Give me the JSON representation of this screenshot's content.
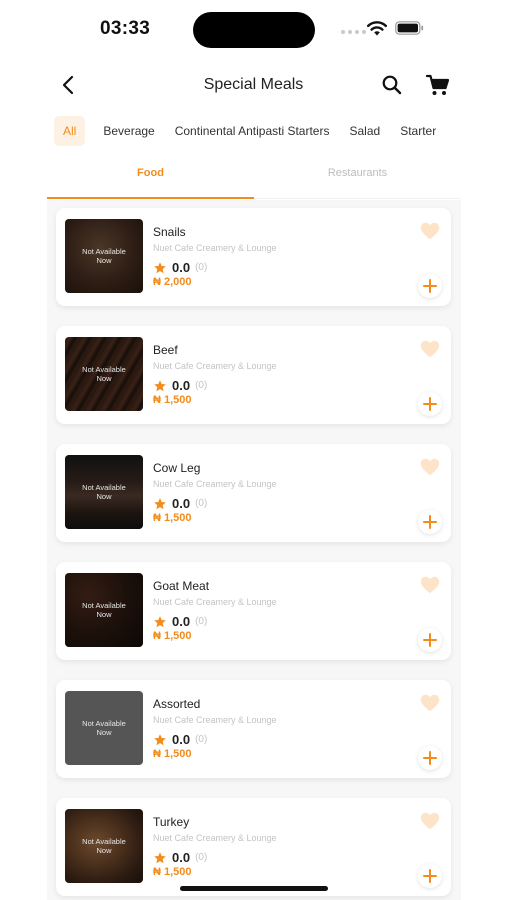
{
  "status_bar": {
    "time": "03:33"
  },
  "header": {
    "title": "Special Meals"
  },
  "categories": [
    "All",
    "Beverage",
    "Continental Antipasti Starters",
    "Salad",
    "Starter"
  ],
  "tabs": {
    "food": "Food",
    "restaurants": "Restaurants"
  },
  "overlay_text": "Not Available Now",
  "colors": {
    "accent": "#f28c1c",
    "accent_light": "#fdf1e3",
    "heart": "#fde3c8"
  },
  "items": [
    {
      "name": "Snails",
      "vendor": "Nuet Cafe Creamery & Lounge",
      "rating": "0.0",
      "reviews": "(0)",
      "price": "₦ 2,000"
    },
    {
      "name": "Beef",
      "vendor": "Nuet Cafe Creamery & Lounge",
      "rating": "0.0",
      "reviews": "(0)",
      "price": "₦ 1,500"
    },
    {
      "name": "Cow Leg",
      "vendor": "Nuet Cafe Creamery & Lounge",
      "rating": "0.0",
      "reviews": "(0)",
      "price": "₦ 1,500"
    },
    {
      "name": "Goat Meat",
      "vendor": "Nuet Cafe Creamery & Lounge",
      "rating": "0.0",
      "reviews": "(0)",
      "price": "₦ 1,500"
    },
    {
      "name": "Assorted",
      "vendor": "Nuet Cafe Creamery & Lounge",
      "rating": "0.0",
      "reviews": "(0)",
      "price": "₦ 1,500"
    },
    {
      "name": "Turkey",
      "vendor": "Nuet Cafe Creamery & Lounge",
      "rating": "0.0",
      "reviews": "(0)",
      "price": "₦ 1,500"
    }
  ]
}
